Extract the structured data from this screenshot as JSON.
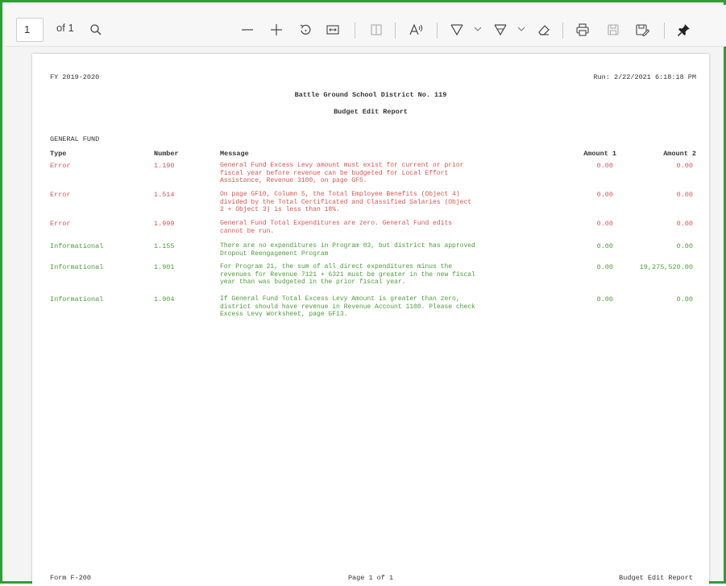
{
  "toolbar": {
    "page_number": "1",
    "page_of": "of 1",
    "icons": [
      "search-icon",
      "zoom-out-icon",
      "zoom-in-icon",
      "rotate-icon",
      "fit-width-icon",
      "page-view-icon",
      "read-aloud-icon",
      "draw-icon",
      "highlight-icon",
      "erase-icon",
      "print-icon",
      "save-icon",
      "save-as-icon",
      "pin-icon"
    ]
  },
  "report": {
    "fiscal_year": "FY 2019-2020",
    "run_date": "Run: 2/22/2021 6:18:18 PM",
    "district": "Battle Ground School District No. 119",
    "title": "Budget Edit Report",
    "section": "GENERAL FUND",
    "columns": {
      "type": "Type",
      "number": "Number",
      "message": "Message",
      "amount1": "Amount 1",
      "amount2": "Amount 2"
    },
    "rows": [
      {
        "type": "Error",
        "number": "1.190",
        "message_lines": [
          "General Fund Excess Levy amount must exist for current or prior",
          "fiscal year before revenue can be budgeted for Local Effort",
          "Assistance, Revenue 3100, on page GF5."
        ],
        "amount1": "0.00",
        "amount2": "0.00",
        "severity_color": "#d9534f"
      },
      {
        "type": "Error",
        "number": "1.514",
        "message_lines": [
          "On page GF10, Column 5, the Total Employee Benefits (Object 4)",
          "divided by the Total Certificated and Classified Salaries (Object",
          "2 + Object 3) is less than 18%."
        ],
        "amount1": "0.00",
        "amount2": "0.00",
        "severity_color": "#d9534f"
      },
      {
        "type": "Error",
        "number": "1.999",
        "message_lines": [
          "General Fund Total Expenditures are zero. General Fund edits",
          "cannot be run."
        ],
        "amount1": "0.00",
        "amount2": "0.00",
        "severity_color": "#d9534f"
      },
      {
        "type": "Informational",
        "number": "1.155",
        "message_lines": [
          "There are no expenditures in Program 03, but district has approved",
          "Dropout Reengagement Program"
        ],
        "amount1": "0.00",
        "amount2": "0.00",
        "severity_color": "#4e9b3a"
      },
      {
        "type": "Informational",
        "number": "1.901",
        "message_lines": [
          "For Program 21, the sum of all direct expenditures minus the",
          "revenues for Revenue 7121 + 6321 must be greater in the new fiscal",
          "year than was budgeted in the prior fiscal year."
        ],
        "amount1": "0.00",
        "amount2": "19,275,520.00",
        "severity_color": "#4e9b3a"
      },
      {
        "type": "Informational",
        "number": "1.904",
        "message_lines": [
          "If General Fund Total Excess Levy Amount is greater than zero,",
          "district should have revenue in Revenue Account 1100. Please check",
          "Excess Levy Worksheet, page GF13."
        ],
        "amount1": "0.00",
        "amount2": "0.00",
        "severity_color": "#4e9b3a"
      }
    ],
    "footer": {
      "form": "Form F-200",
      "page": "Page 1 of 1",
      "report_name": "Budget Edit Report"
    }
  }
}
